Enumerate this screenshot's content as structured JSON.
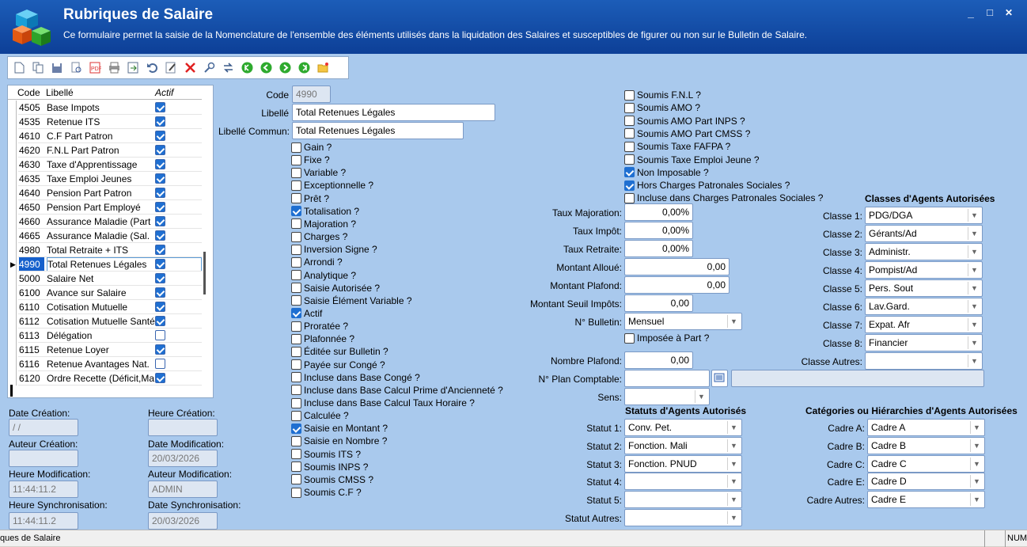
{
  "window": {
    "title": "Rubriques de Salaire",
    "description": "Ce formulaire permet la saisie de la Nomenclature de l'ensemble des éléments utilisés dans la liquidation des Salaires et susceptibles de figurer ou non sur le Bulletin de Salaire.",
    "minimize": "_",
    "maximize": "□",
    "close": "✕"
  },
  "toolbar": {
    "icons": [
      "new-icon",
      "copy-icon",
      "save-icon",
      "print-preview-icon",
      "pdf-icon",
      "print-icon",
      "export-icon",
      "undo-icon",
      "edit-icon",
      "delete-icon",
      "search-icon",
      "refresh-icon",
      "first-record-icon",
      "previous-record-icon",
      "next-record-icon",
      "last-record-icon",
      "open-folder-icon"
    ]
  },
  "grid": {
    "headers": {
      "code": "Code",
      "label": "Libellé",
      "active": "Actif"
    },
    "rows": [
      {
        "code": "4505",
        "label": "Base Impots",
        "active": true
      },
      {
        "code": "4535",
        "label": "Retenue ITS",
        "active": true
      },
      {
        "code": "4610",
        "label": "C.F Part Patron",
        "active": true
      },
      {
        "code": "4620",
        "label": "F.N.L Part Patron",
        "active": true
      },
      {
        "code": "4630",
        "label": "Taxe d'Apprentissage",
        "active": true
      },
      {
        "code": "4635",
        "label": "Taxe Emploi Jeunes",
        "active": true
      },
      {
        "code": "4640",
        "label": "Pension Part Patron",
        "active": true
      },
      {
        "code": "4650",
        "label": "Pension Part Employé",
        "active": true
      },
      {
        "code": "4660",
        "label": "Assurance Maladie (Part",
        "active": true
      },
      {
        "code": "4665",
        "label": "Assurance Maladie (Sal.",
        "active": true
      },
      {
        "code": "4980",
        "label": "Total Retraite + ITS",
        "active": true
      },
      {
        "code": "4990",
        "label": "Total Retenues Légales",
        "active": true,
        "selected": true
      },
      {
        "code": "5000",
        "label": "Salaire Net",
        "active": true
      },
      {
        "code": "6100",
        "label": "Avance sur Salaire",
        "active": true
      },
      {
        "code": "6110",
        "label": "Cotisation Mutuelle",
        "active": true
      },
      {
        "code": "6112",
        "label": "Cotisation Mutuelle Santé",
        "active": true
      },
      {
        "code": "6113",
        "label": "Délégation",
        "active": false
      },
      {
        "code": "6115",
        "label": "Retenue Loyer",
        "active": true
      },
      {
        "code": "6116",
        "label": "Retenue Avantages Nat.",
        "active": false
      },
      {
        "code": "6120",
        "label": "Ordre Recette (Déficit,Ma",
        "active": true
      }
    ]
  },
  "audit": {
    "date_creation_label": "Date Création:",
    "date_creation": " / /",
    "heure_creation_label": "Heure Création:",
    "heure_creation": "",
    "auteur_creation_label": "Auteur Création:",
    "auteur_creation": "",
    "date_modification_label": "Date Modification:",
    "date_modification": "20/03/2026",
    "heure_modification_label": "Heure Modification:",
    "heure_modification": "11:44:11.2",
    "auteur_modification_label": "Auteur Modification:",
    "auteur_modification": "ADMIN",
    "heure_sync_label": "Heure Synchronisation:",
    "heure_sync": "11:44:11.2",
    "date_sync_label": "Date Synchronisation:",
    "date_sync": "20/03/2026"
  },
  "fields": {
    "code_label": "Code",
    "code": "4990",
    "libelle_label": "Libellé",
    "libelle": "Total Retenues Légales",
    "libelle_commun_label": "Libellé Commun:",
    "libelle_commun": "Total Retenues Légales"
  },
  "checks_left": [
    {
      "label": "Gain ?",
      "checked": false
    },
    {
      "label": "Fixe ?",
      "checked": false
    },
    {
      "label": "Variable ?",
      "checked": false
    },
    {
      "label": "Exceptionnelle ?",
      "checked": false
    },
    {
      "label": "Prêt ?",
      "checked": false
    },
    {
      "label": "Totalisation ?",
      "checked": true
    },
    {
      "label": "Majoration ?",
      "checked": false
    },
    {
      "label": "Charges ?",
      "checked": false
    },
    {
      "label": "Inversion Signe ?",
      "checked": false
    },
    {
      "label": "Arrondi ?",
      "checked": false
    },
    {
      "label": "Analytique ?",
      "checked": false
    },
    {
      "label": "Saisie Autorisée ?",
      "checked": false
    },
    {
      "label": "Saisie Élément Variable ?",
      "checked": false
    },
    {
      "label": "Actif",
      "checked": true
    },
    {
      "label": "Proratée ?",
      "checked": false
    },
    {
      "label": "Plafonnée ?",
      "checked": false
    },
    {
      "label": "Éditée sur Bulletin ?",
      "checked": false
    },
    {
      "label": "Payée sur Congé ?",
      "checked": false
    },
    {
      "label": "Incluse dans Base Congé ?",
      "checked": false
    },
    {
      "label": "Incluse dans Base Calcul Prime d'Ancienneté ?",
      "checked": false
    },
    {
      "label": "Incluse dans Base Calcul Taux Horaire ?",
      "checked": false
    },
    {
      "label": "Calculée ?",
      "checked": false
    },
    {
      "label": "Saisie en Montant ?",
      "checked": true
    },
    {
      "label": "Saisie en Nombre ?",
      "checked": false
    },
    {
      "label": "Soumis ITS ?",
      "checked": false
    },
    {
      "label": "Soumis INPS ?",
      "checked": false
    },
    {
      "label": "Soumis CMSS ?",
      "checked": false
    },
    {
      "label": "Soumis C.F ?",
      "checked": false
    }
  ],
  "checks_right": [
    {
      "label": "Soumis F.N.L ?",
      "checked": false
    },
    {
      "label": "Soumis AMO ?",
      "checked": false
    },
    {
      "label": "Soumis AMO Part INPS ?",
      "checked": false
    },
    {
      "label": "Soumis AMO Part CMSS ?",
      "checked": false
    },
    {
      "label": "Soumis Taxe FAFPA ?",
      "checked": false
    },
    {
      "label": "Soumis Taxe Emploi Jeune ?",
      "checked": false
    },
    {
      "label": "Non Imposable ?",
      "checked": true
    },
    {
      "label": "Hors Charges Patronales Sociales ?",
      "checked": true
    },
    {
      "label": "Incluse dans Charges Patronales Sociales ?",
      "checked": false
    }
  ],
  "rates": {
    "taux_majoration_label": "Taux Majoration:",
    "taux_majoration": "0,00%",
    "taux_impot_label": "Taux Impôt:",
    "taux_impot": "0,00%",
    "taux_retraite_label": "Taux Retraite:",
    "taux_retraite": "0,00%",
    "montant_alloue_label": "Montant Alloué:",
    "montant_alloue": "0,00",
    "montant_plafond_label": "Montant Plafond:",
    "montant_plafond": "0,00",
    "seuil_impots_label": "Montant Seuil Impôts:",
    "seuil_impots": "0,00",
    "bulletin_label": "N° Bulletin:",
    "bulletin": "Mensuel",
    "imposee_label": "Imposée à Part ?",
    "nombre_plafond_label": "Nombre Plafond:",
    "nombre_plafond": "0,00",
    "plan_comptable_label": "N° Plan Comptable:",
    "plan_comptable": "",
    "sens_label": "Sens:",
    "sens": ""
  },
  "classes": {
    "title": "Classes d'Agents Autorisées",
    "items": [
      {
        "label": "Classe 1:",
        "value": "PDG/DGA"
      },
      {
        "label": "Classe 2:",
        "value": "Gérants/Ad"
      },
      {
        "label": "Classe 3:",
        "value": "Administr."
      },
      {
        "label": "Classe 4:",
        "value": "Pompist/Ad"
      },
      {
        "label": "Classe 5:",
        "value": "Pers. Sout"
      },
      {
        "label": "Classe 6:",
        "value": "Lav.Gard."
      },
      {
        "label": "Classe 7:",
        "value": "Expat. Afr"
      },
      {
        "label": "Classe 8:",
        "value": "Financier"
      },
      {
        "label": "Classe Autres:",
        "value": ""
      }
    ]
  },
  "statuts": {
    "title": "Statuts d'Agents Autorisés",
    "items": [
      {
        "label": "Statut 1:",
        "value": "Conv. Pet."
      },
      {
        "label": "Statut 2:",
        "value": "Fonction. Mali"
      },
      {
        "label": "Statut 3:",
        "value": "Fonction. PNUD"
      },
      {
        "label": "Statut 4:",
        "value": ""
      },
      {
        "label": "Statut 5:",
        "value": ""
      },
      {
        "label": "Statut Autres:",
        "value": ""
      }
    ]
  },
  "cadres": {
    "title": "Catégories ou Hiérarchies d'Agents Autorisées",
    "items": [
      {
        "label": "Cadre A:",
        "value": "Cadre A"
      },
      {
        "label": "Cadre B:",
        "value": "Cadre B"
      },
      {
        "label": "Cadre C:",
        "value": "Cadre C"
      },
      {
        "label": "Cadre E:",
        "value": "Cadre D"
      },
      {
        "label": "Cadre Autres:",
        "value": "Cadre E"
      }
    ]
  },
  "status_bar": {
    "text": "ques de Salaire",
    "num": "NUM"
  }
}
